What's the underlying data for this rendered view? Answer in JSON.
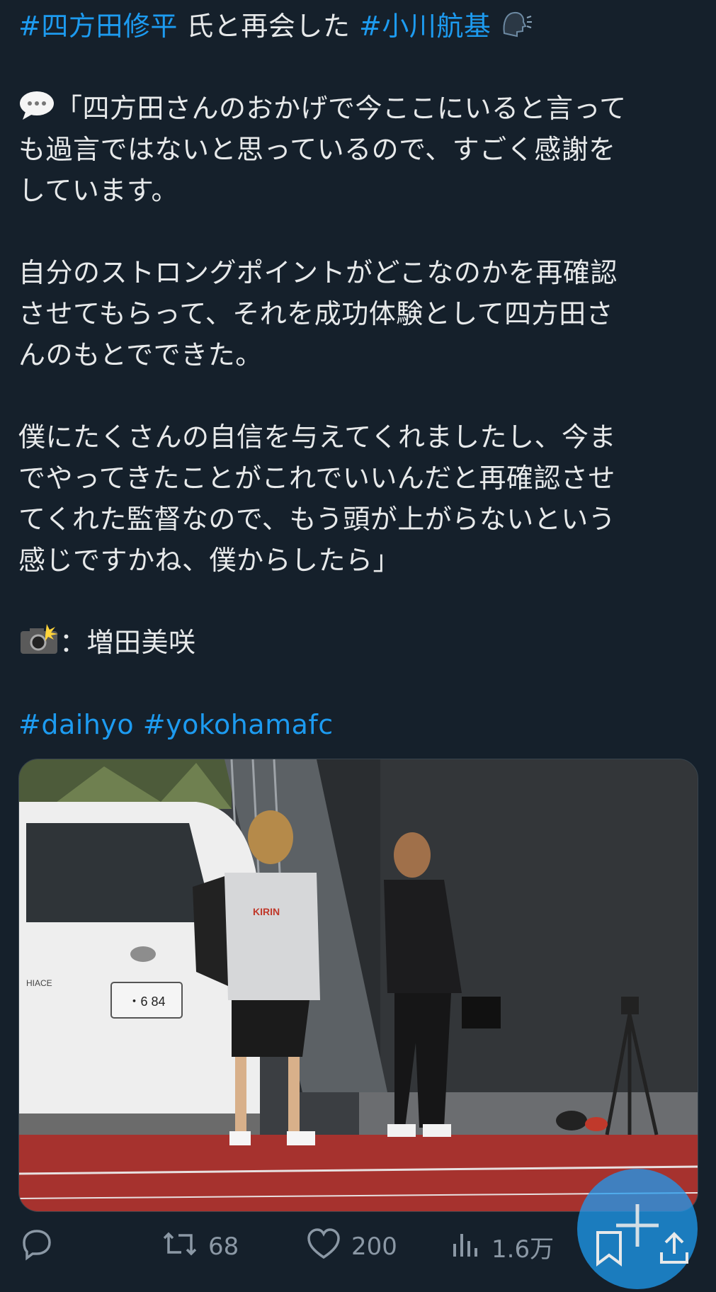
{
  "tweet": {
    "line1_tag1": "#四方田修平",
    "line1_mid": " 氏と再会した ",
    "line1_tag2": "#小川航基",
    "quote_lines": [
      "「四方田さんのおかげで今ここにいると言って",
      "も過言ではないと思っているので、すごく感謝を",
      "しています。"
    ],
    "para2": [
      "自分のストロングポイントがどこなのかを再確認",
      "させてもらって、それを成功体験として四方田さ",
      "んのもとでできた。"
    ],
    "para3": [
      "僕にたくさんの自信を与えてくれましたし、今ま",
      "でやってきたことがこれでいいんだと再確認させ",
      "てくれた監督なので、もう頭が上がらないという",
      "感じですかね、僕からしたら」"
    ],
    "photo_credit": "：増田美咲",
    "hashtags": [
      "#daihyo",
      "#yokohamafc"
    ]
  },
  "photo": {
    "car_plate": "・6 84",
    "car_badge": "HIACE",
    "shirt_sponsor": "KIRIN"
  },
  "actions": {
    "retweets": "68",
    "likes": "200",
    "views": "1.6万"
  },
  "colors": {
    "background": "#15202b",
    "link": "#1d9bf0",
    "muted": "#8b98a5"
  },
  "icons": [
    "speaking-head-icon",
    "speech-balloon-icon",
    "camera-flash-icon",
    "reply-icon",
    "retweet-icon",
    "like-icon",
    "views-icon",
    "bookmark-icon",
    "share-icon",
    "compose-plus-icon"
  ]
}
